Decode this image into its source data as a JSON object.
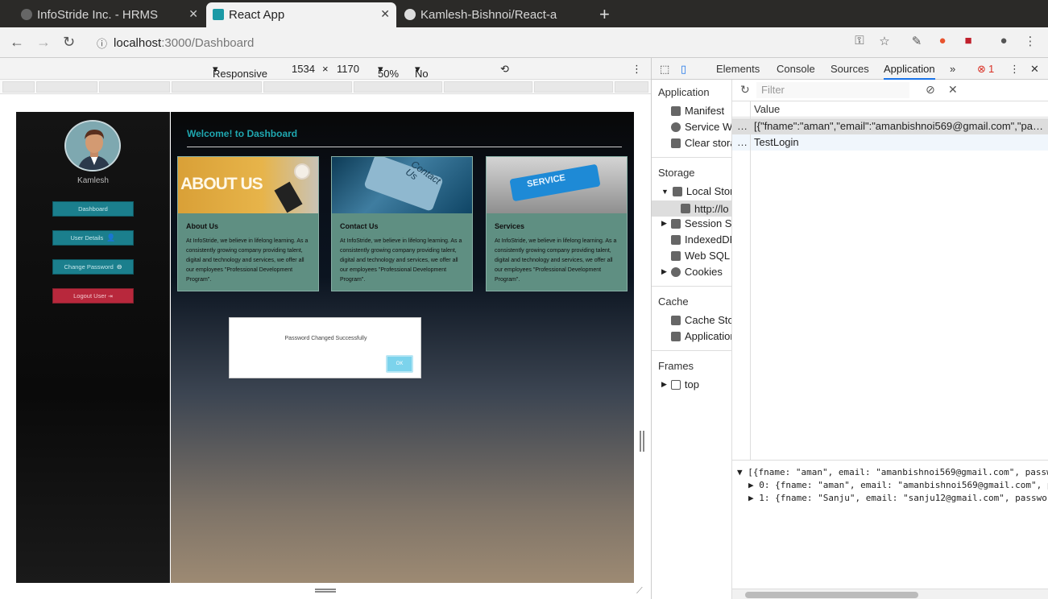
{
  "tabs": [
    {
      "title": "InfoStride Inc. - HRMS"
    },
    {
      "title": "React App"
    },
    {
      "title": "Kamlesh-Bishnoi/React-a"
    }
  ],
  "url": {
    "host": "localhost",
    "path": ":3000/Dashboard"
  },
  "devicebar": {
    "mode": "Responsive",
    "width": "1534",
    "x": "×",
    "height": "1170",
    "zoom": "50%",
    "throttle": "No throttling"
  },
  "app": {
    "username": "Kamlesh",
    "buttons": {
      "dashboard": "Dashboard",
      "user_details": "User Details",
      "change_password": "Change Password",
      "logout": "Logout User"
    },
    "welcome": "Welcome! to Dashboard",
    "cards": [
      {
        "title": "About Us",
        "banner": "ABOUT US",
        "text": "At InfoStride, we believe in lifelong learning. As a consistently growing company providing talent, digital and technology and services, we offer all our employees \"Professional Development Program\"."
      },
      {
        "title": "Contact Us",
        "banner": "Contact Us",
        "text": "At InfoStride, we believe in lifelong learning. As a consistently growing company providing talent, digital and technology and services, we offer all our employees \"Professional Development Program\"."
      },
      {
        "title": "Services",
        "banner": "SERVICE",
        "text": "At InfoStride, we believe in lifelong learning. As a consistently growing company providing talent, digital and technology and services, we offer all our employees \"Professional Development Program\"."
      }
    ],
    "dialog": {
      "message": "Password Changed Successfully",
      "ok": "OK"
    }
  },
  "devtools": {
    "tabs": {
      "elements": "Elements",
      "console": "Console",
      "sources": "Sources",
      "application": "Application",
      "more": "»",
      "errors": "1"
    },
    "sidebar": {
      "application": "Application",
      "manifest": "Manifest",
      "service_workers": "Service Wo",
      "clear_storage": "Clear stora",
      "storage": "Storage",
      "local_storage": "Local Stora",
      "local_origin": "http://lo",
      "session_storage": "Session Sto",
      "indexeddb": "IndexedDE",
      "websql": "Web SQL",
      "cookies": "Cookies",
      "cache": "Cache",
      "cache_storage": "Cache Stor",
      "app_cache": "Application",
      "frames": "Frames",
      "top": "top"
    },
    "filter_placeholder": "Filter",
    "value_header": "Value",
    "rows": [
      {
        "key": "…",
        "value": "[{\"fname\":\"aman\",\"email\":\"amanbishnoi569@gmail.com\",\"pas…"
      },
      {
        "key": "…",
        "value": "TestLogin"
      }
    ],
    "console": [
      "▼ [{fname: \"aman\", email: \"amanbishnoi569@gmail.com\", passw",
      "▶ 0: {fname: \"aman\", email: \"amanbishnoi569@gmail.com\", p",
      "▶ 1: {fname: \"Sanju\", email: \"sanju12@gmail.com\", passwor"
    ]
  }
}
